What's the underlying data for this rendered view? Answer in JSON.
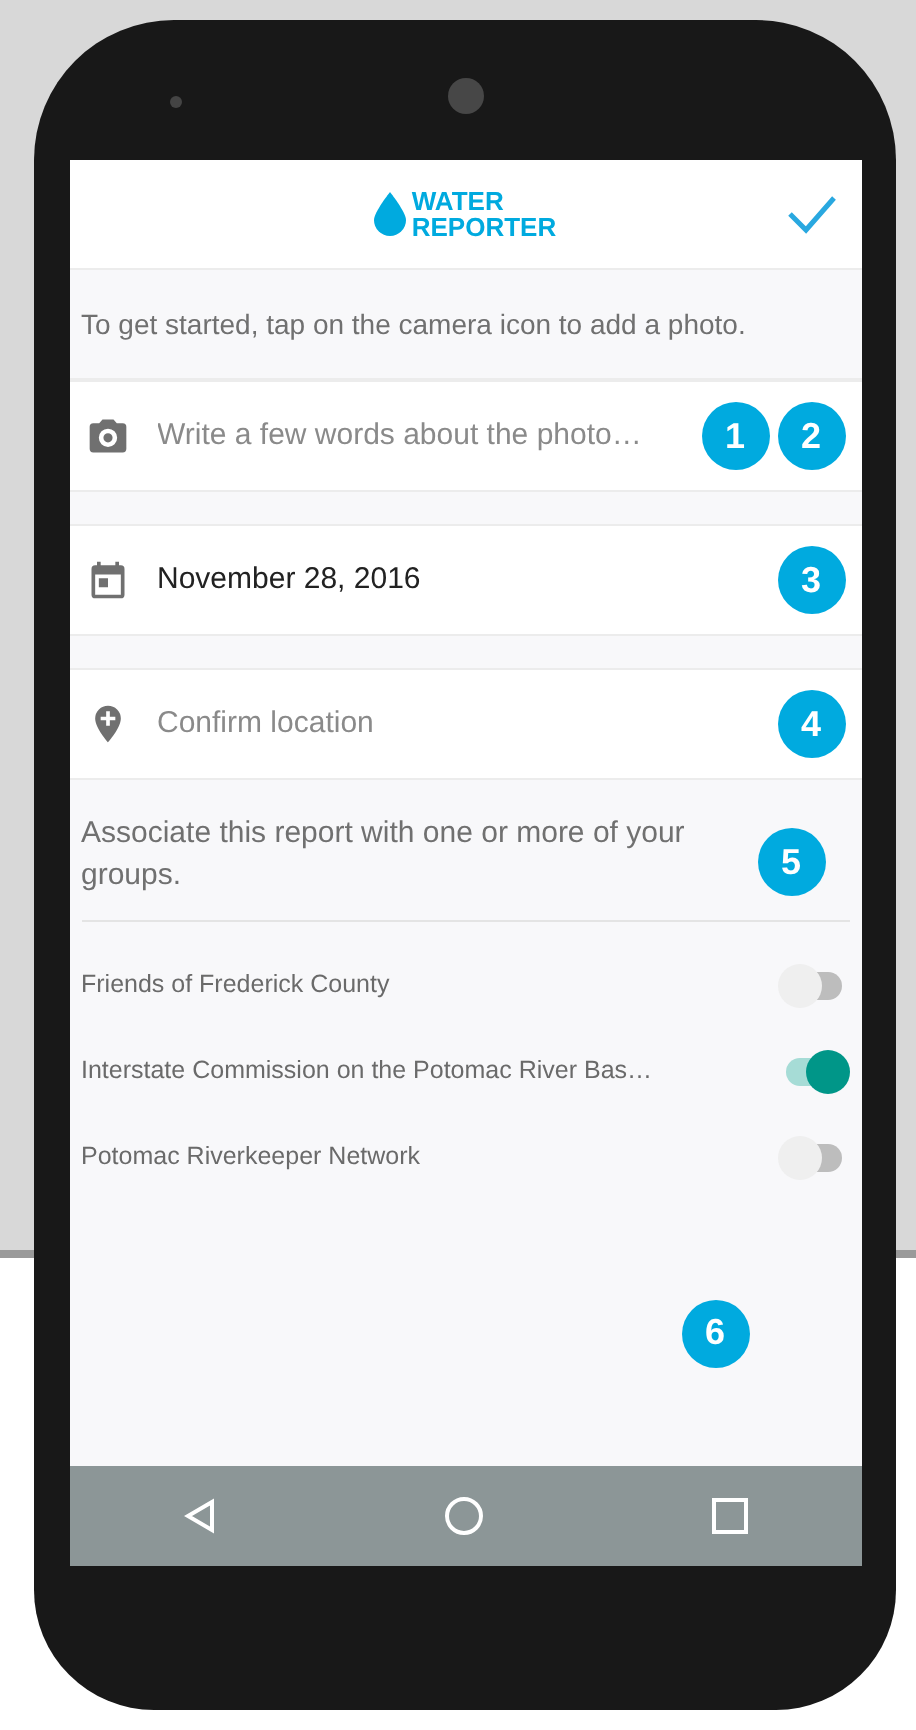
{
  "header": {
    "logo_line_1": "WATER",
    "logo_line_2": "REPORTER"
  },
  "instruction": "To get started, tap on the camera icon to add a photo.",
  "fields": [
    {
      "kind": "photo",
      "placeholder": "Write a few words about the photo…"
    },
    {
      "kind": "date",
      "value": "November 28, 2016"
    },
    {
      "kind": "location",
      "placeholder": "Confirm location"
    }
  ],
  "groups_prompt": "Associate this report with one or more of your groups.",
  "groups": [
    {
      "name": "Friends of Frederick County",
      "on": false
    },
    {
      "name": "Interstate Commission on the Potomac River Bas…",
      "on": true
    },
    {
      "name": "Potomac Riverkeeper Network",
      "on": false
    }
  ],
  "callouts": [
    "1",
    "2",
    "3",
    "4",
    "5",
    "6"
  ]
}
